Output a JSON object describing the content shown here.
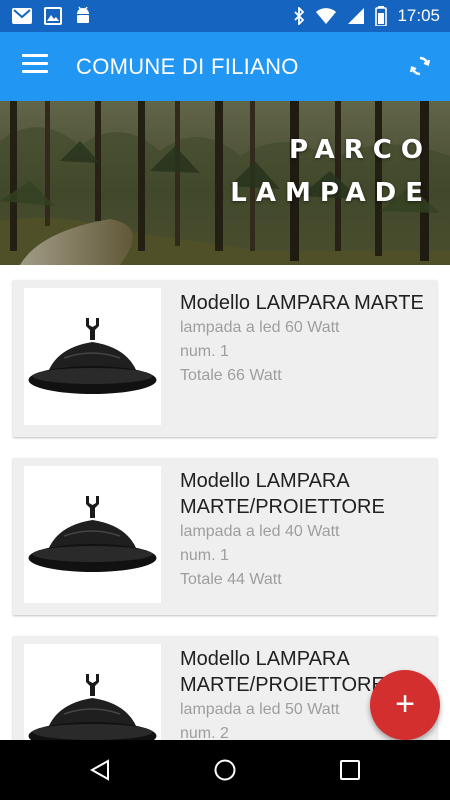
{
  "status_bar": {
    "time": "17:05",
    "icons": [
      "gmail-icon",
      "image-icon",
      "android-icon",
      "bluetooth-icon",
      "wifi-icon",
      "signal-icon",
      "battery-icon"
    ],
    "color": "#1565c0"
  },
  "app_bar": {
    "title": "COMUNE DI FILIANO",
    "menu_icon": "hamburger-menu-icon",
    "action_icon": "refresh-icon",
    "color": "#2196f3"
  },
  "banner": {
    "line1": "PARCO",
    "line2": "LAMPADE"
  },
  "cards": [
    {
      "title": "Modello LAMPARA MARTE",
      "line1": "lampada a led 60 Watt",
      "line2": "num. 1",
      "line3": "Totale 66 Watt"
    },
    {
      "title": "Modello LAMPARA MARTE/PROIETTORE",
      "line1": "lampada a led 40 Watt",
      "line2": "num. 1",
      "line3": "Totale 44 Watt"
    },
    {
      "title": "Modello LAMPARA MARTE/PROIETTORE",
      "line1": "lampada a led 50 Watt",
      "line2": "num. 2",
      "line3": ""
    }
  ],
  "fab": {
    "label": "+",
    "color": "#d32f2f"
  },
  "nav_bar": {
    "buttons": [
      "back-icon",
      "home-icon",
      "recents-icon"
    ]
  }
}
